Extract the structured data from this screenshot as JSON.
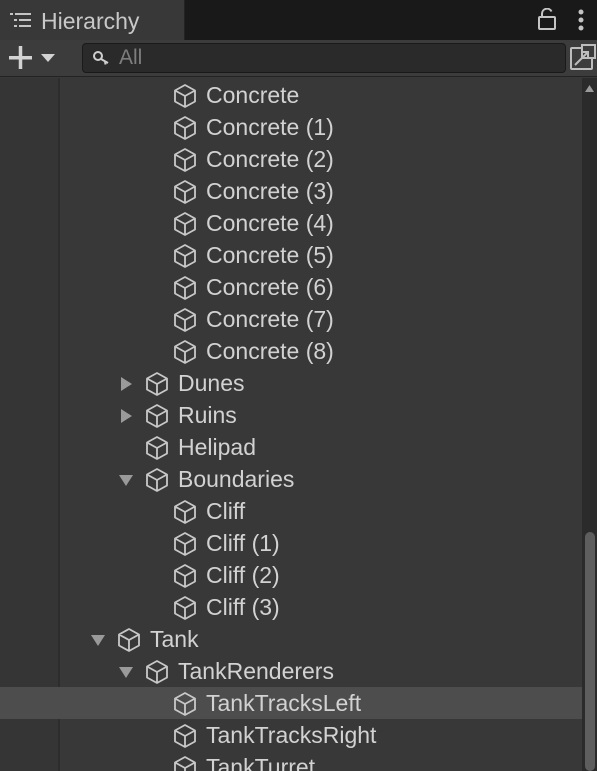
{
  "window": {
    "tab_title": "Hierarchy",
    "tab_icon": "hierarchy-list-icon",
    "lock_icon": "lock-icon",
    "menu_icon": "more-vertical-icon"
  },
  "toolbar": {
    "add_icon": "plus-icon",
    "dropdown_icon": "caret-down-icon",
    "search_icon": "search-icon",
    "search_placeholder": "All",
    "search_value": "",
    "scene_icon": "open-scene-window-icon"
  },
  "tree": {
    "object_icon": "gameobject-cube-icon",
    "selection_color": "#4d4d4d",
    "rows": [
      {
        "label": "Concrete",
        "depth": 4,
        "arrow": "none",
        "selected": false
      },
      {
        "label": "Concrete (1)",
        "depth": 4,
        "arrow": "none",
        "selected": false
      },
      {
        "label": "Concrete (2)",
        "depth": 4,
        "arrow": "none",
        "selected": false
      },
      {
        "label": "Concrete (3)",
        "depth": 4,
        "arrow": "none",
        "selected": false
      },
      {
        "label": "Concrete (4)",
        "depth": 4,
        "arrow": "none",
        "selected": false
      },
      {
        "label": "Concrete (5)",
        "depth": 4,
        "arrow": "none",
        "selected": false
      },
      {
        "label": "Concrete (6)",
        "depth": 4,
        "arrow": "none",
        "selected": false
      },
      {
        "label": "Concrete (7)",
        "depth": 4,
        "arrow": "none",
        "selected": false
      },
      {
        "label": "Concrete (8)",
        "depth": 4,
        "arrow": "none",
        "selected": false
      },
      {
        "label": "Dunes",
        "depth": 3,
        "arrow": "collapsed",
        "selected": false
      },
      {
        "label": "Ruins",
        "depth": 3,
        "arrow": "collapsed",
        "selected": false
      },
      {
        "label": "Helipad",
        "depth": 3,
        "arrow": "none",
        "selected": false
      },
      {
        "label": "Boundaries",
        "depth": 3,
        "arrow": "expanded",
        "selected": false
      },
      {
        "label": "Cliff",
        "depth": 4,
        "arrow": "none",
        "selected": false
      },
      {
        "label": "Cliff (1)",
        "depth": 4,
        "arrow": "none",
        "selected": false
      },
      {
        "label": "Cliff (2)",
        "depth": 4,
        "arrow": "none",
        "selected": false
      },
      {
        "label": "Cliff (3)",
        "depth": 4,
        "arrow": "none",
        "selected": false
      },
      {
        "label": "Tank",
        "depth": 2,
        "arrow": "expanded",
        "selected": false
      },
      {
        "label": "TankRenderers",
        "depth": 3,
        "arrow": "expanded",
        "selected": false
      },
      {
        "label": "TankTracksLeft",
        "depth": 4,
        "arrow": "none",
        "selected": true
      },
      {
        "label": "TankTracksRight",
        "depth": 4,
        "arrow": "none",
        "selected": false
      },
      {
        "label": "TankTurret",
        "depth": 4,
        "arrow": "none",
        "selected": false
      }
    ]
  },
  "scrollbar": {
    "up_icon": "scroll-up-arrow-icon",
    "position_fraction": 0.68
  }
}
